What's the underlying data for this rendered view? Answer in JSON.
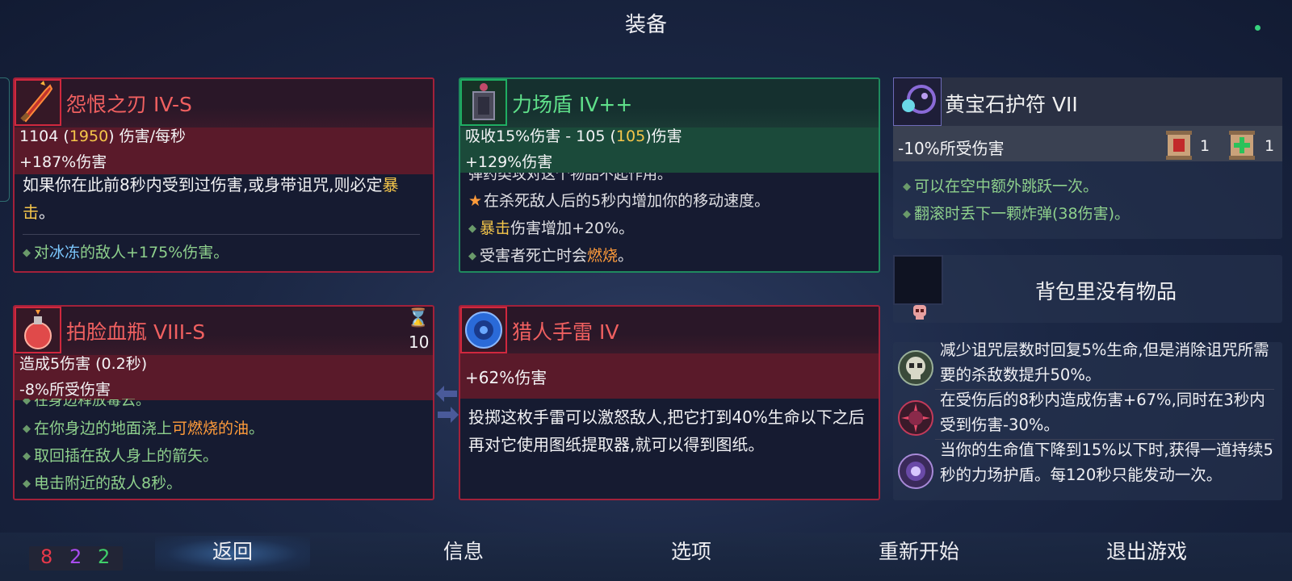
{
  "page": {
    "title": "装备"
  },
  "weapon1": {
    "name": "怨恨之刃 IV-S",
    "dps": "1104",
    "dps_alt": "1950",
    "dps_suffix": "伤害/每秒",
    "stat2": "+187%伤害",
    "desc_part1": "如果你在此前8秒内受到过伤害,或身带诅咒,则必定",
    "desc_highlight": "暴击",
    "desc_end": "。",
    "bullet_part1": "对",
    "bullet_keyword": "冰冻",
    "bullet_part2": "的敌人+175%伤害。"
  },
  "shield": {
    "name": "力场盾 IV++",
    "stat_prefix": "吸收15%伤害 - 105 (",
    "stat_alt": "105",
    "stat_suffix": ")伤害",
    "stat2": "+129%伤害",
    "cut_line": "弹药类攻对这个物品不起作用。",
    "bullet1": "在杀死敌人后的5秒内增加你的移动速度。",
    "bullet2_keyword": "暴击",
    "bullet2_rest": "伤害增加+20%。",
    "bullet3_prefix": "受害者死亡时会",
    "bullet3_keyword": "燃烧",
    "bullet3_end": "。"
  },
  "amulet": {
    "name": "黄宝石护符 VII",
    "stat": "-10%所受伤害",
    "scroll_red_count": "1",
    "scroll_green_count": "1",
    "bullet1": "可以在空中额外跳跃一次。",
    "bullet2": "翻滚时丢下一颗炸弹(38伤害)。"
  },
  "flask": {
    "name": "拍脸血瓶 VIII-S",
    "cooldown": "10",
    "stat1": "造成5伤害 (0.2秒)",
    "stat2": "-8%所受伤害",
    "cut_line": "在身边释放毒云。",
    "bullet1_prefix": "在你身边的地面浇上",
    "bullet1_keyword": "可燃烧的油",
    "bullet1_end": "。",
    "bullet2": "取回插在敌人身上的箭矢。",
    "bullet3": "电击附近的敌人8秒。"
  },
  "grenade": {
    "name": "猎人手雷 IV",
    "stat": "+62%伤害",
    "desc": "投掷这枚手雷可以激怒敌人,把它打到40%生命以下之后再对它使用图纸提取器,就可以得到图纸。"
  },
  "backpack": {
    "empty_text": "背包里没有物品"
  },
  "mutations": [
    {
      "text": "减少诅咒层数时回复5%生命,但是消除诅咒所需要的杀敌数提升50%。",
      "icon": "skull-icon"
    },
    {
      "text": "在受伤后的8秒内造成伤害+67%,同时在3秒内受到伤害-30%。",
      "icon": "spiked-ball-icon"
    },
    {
      "text": "当你的生命值下降到15%以下时,获得一道持续5秒的力场护盾。每120秒只能发动一次。",
      "icon": "shield-orb-icon"
    }
  ],
  "scrolls": {
    "brutality": "8",
    "tactics": "2",
    "survival": "2"
  },
  "nav": {
    "back": "返回",
    "info": "信息",
    "options": "选项",
    "restart": "重新开始",
    "quit": "退出游戏"
  },
  "colors": {
    "brutality": "#e8384a",
    "tactics": "#a84cf0",
    "survival": "#3fcf6a",
    "highlight_gold": "#f5c64a",
    "highlight_orange": "#ff9b3a",
    "bullet_green": "#8ed08c"
  }
}
